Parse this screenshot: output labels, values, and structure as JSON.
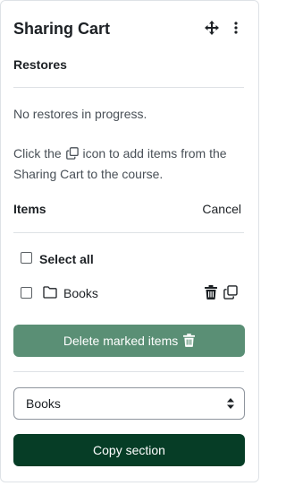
{
  "block": {
    "title": "Sharing Cart",
    "move_icon": "move-arrows-icon",
    "menu_icon": "kebab-menu-icon"
  },
  "restores": {
    "heading": "Restores",
    "status": "No restores in progress.",
    "help_before": "Click the",
    "help_icon": "copy-icon",
    "help_after": "icon to add items from the Sharing Cart to the course."
  },
  "items": {
    "heading": "Items",
    "cancel_label": "Cancel",
    "select_all_label": "Select all",
    "list": [
      {
        "label": "Books",
        "icon": "folder-icon",
        "actions": [
          "trash-icon",
          "copy-icon"
        ]
      }
    ],
    "delete_button_label": "Delete marked items"
  },
  "section_select": {
    "selected": "Books"
  },
  "copy_button_label": "Copy section",
  "colors": {
    "delete_button_bg": "#5a8f75",
    "copy_button_bg": "#063d26",
    "text": "#1d2125",
    "muted_text": "#495057",
    "rule": "#dee2e6"
  }
}
